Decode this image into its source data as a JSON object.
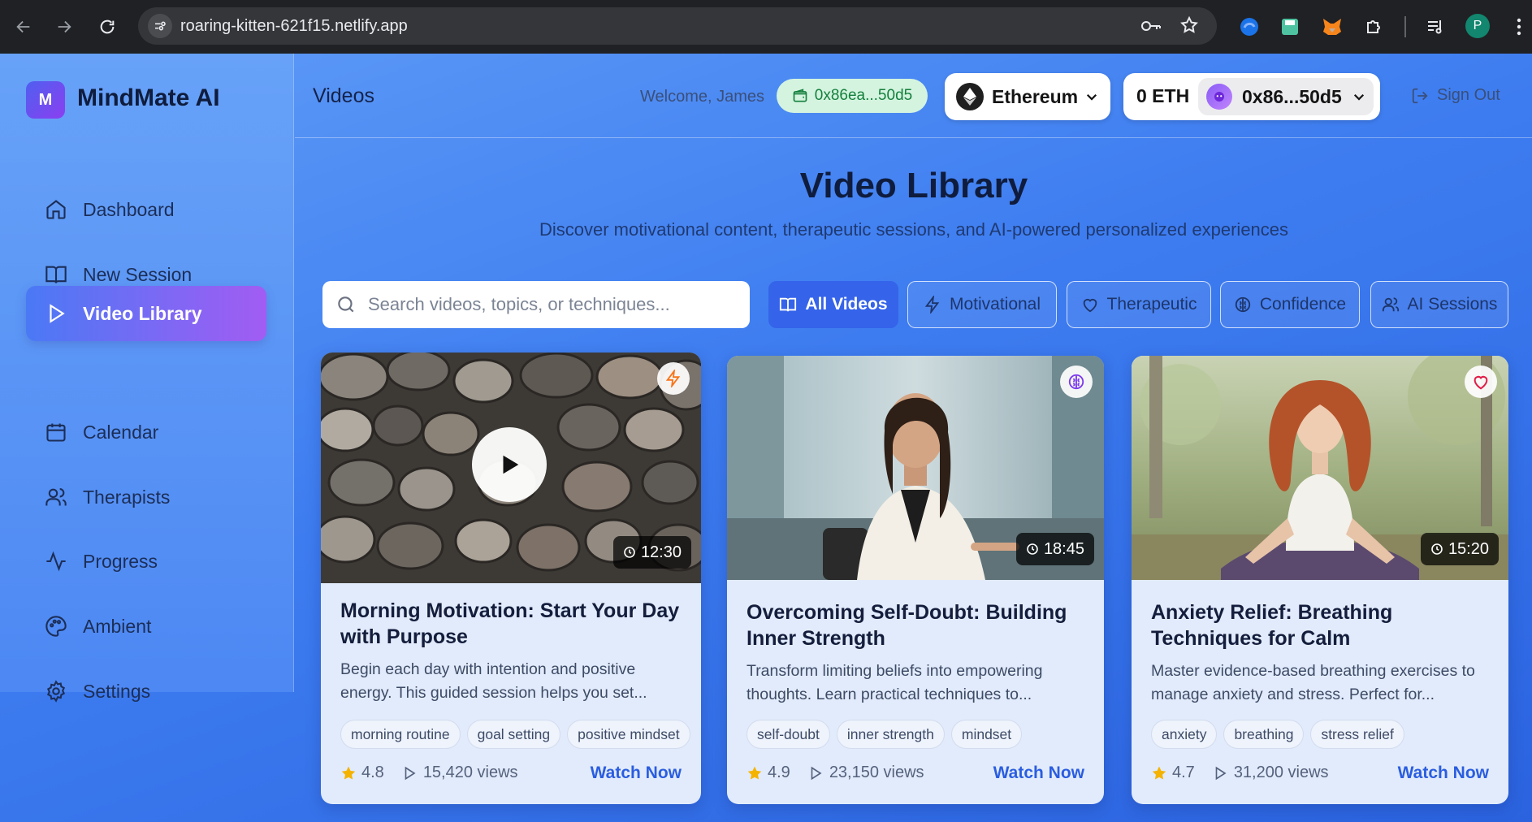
{
  "browser": {
    "url": "roaring-kitten-621f15.netlify.app",
    "profile_initial": "P"
  },
  "app": {
    "logo_letter": "M",
    "name": "MindMate AI"
  },
  "sidebar": {
    "items": [
      {
        "label": "Dashboard",
        "icon": "home-icon"
      },
      {
        "label": "New Session",
        "icon": "book-icon"
      },
      {
        "label": "Video Library",
        "icon": "play-icon",
        "active": true
      },
      {
        "label": "Calendar",
        "icon": "calendar-icon"
      },
      {
        "label": "Therapists",
        "icon": "users-icon"
      },
      {
        "label": "Progress",
        "icon": "activity-icon"
      },
      {
        "label": "Ambient",
        "icon": "palette-icon"
      },
      {
        "label": "Settings",
        "icon": "gear-icon"
      }
    ]
  },
  "header": {
    "title": "Videos",
    "welcome": "Welcome, James",
    "wallet_short": "0x86ea...50d5",
    "network": "Ethereum",
    "balance": "0 ETH",
    "account": "0x86...50d5",
    "signout": "Sign Out"
  },
  "library": {
    "title": "Video Library",
    "subtitle": "Discover motivational content, therapeutic sessions, and AI-powered personalized experiences",
    "search_placeholder": "Search videos, topics, or techniques...",
    "filters": [
      {
        "label": "All Videos",
        "icon": "book-icon",
        "active": true
      },
      {
        "label": "Motivational",
        "icon": "lightning-icon"
      },
      {
        "label": "Therapeutic",
        "icon": "heart-icon"
      },
      {
        "label": "Confidence",
        "icon": "brain-icon"
      },
      {
        "label": "AI Sessions",
        "icon": "users-icon"
      }
    ]
  },
  "videos": [
    {
      "title": "Morning Motivation: Start Your Day with Purpose",
      "description": "Begin each day with intention and positive energy. This guided session helps you set...",
      "duration": "12:30",
      "badge_icon": "lightning-icon",
      "tags": [
        "morning routine",
        "goal setting",
        "positive mindset"
      ],
      "rating": "4.8",
      "views": "15,420 views",
      "cta": "Watch Now"
    },
    {
      "title": "Overcoming Self-Doubt: Building Inner Strength",
      "description": "Transform limiting beliefs into empowering thoughts. Learn practical techniques to...",
      "duration": "18:45",
      "badge_icon": "brain-icon",
      "tags": [
        "self-doubt",
        "inner strength",
        "mindset"
      ],
      "rating": "4.9",
      "views": "23,150 views",
      "cta": "Watch Now"
    },
    {
      "title": "Anxiety Relief: Breathing Techniques for Calm",
      "description": "Master evidence-based breathing exercises to manage anxiety and stress. Perfect for...",
      "duration": "15:20",
      "badge_icon": "heart-icon",
      "tags": [
        "anxiety",
        "breathing",
        "stress relief"
      ],
      "rating": "4.7",
      "views": "31,200 views",
      "cta": "Watch Now"
    }
  ],
  "colors": {
    "accent": "#3563ea",
    "active_nav_gradient_start": "#4a79f5",
    "active_nav_gradient_end": "#a25cf3",
    "wallet_chip": "#d4f4df",
    "cta": "#2a5de0"
  }
}
